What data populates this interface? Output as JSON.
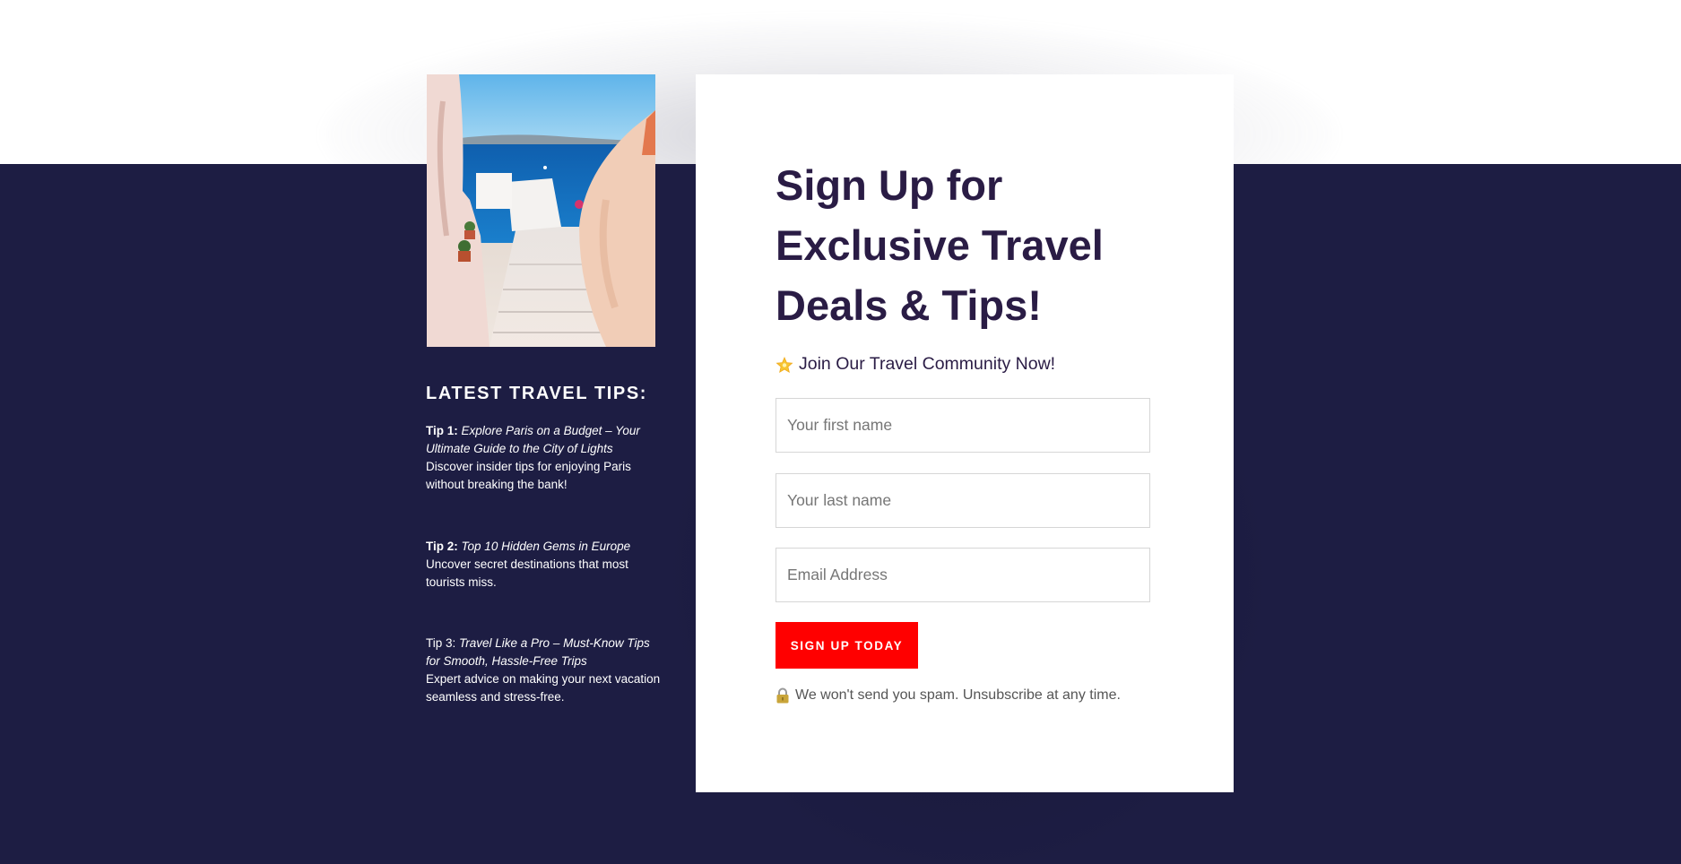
{
  "colors": {
    "band": "#1d1d43",
    "title": "#2a1c45",
    "button": "#ff0000"
  },
  "sidebar": {
    "heading": "LATEST TRAVEL TIPS:",
    "tips": [
      {
        "label": "Tip 1:",
        "title": "Explore Paris on a Budget – Your Ultimate Guide to the City of Lights",
        "description": "Discover insider tips for enjoying Paris without breaking the bank!"
      },
      {
        "label": "Tip 2:",
        "title": "Top 10 Hidden Gems in Europe",
        "description": "Uncover secret destinations that most tourists miss."
      },
      {
        "label": "Tip 3:",
        "title": "Travel Like a Pro – Must-Know Tips for Smooth, Hassle-Free Trips",
        "description": "Expert advice on making your next vacation seamless and stress-free."
      }
    ]
  },
  "form": {
    "title": "Sign Up for Exclusive Travel Deals & Tips!",
    "subtitle": "Join Our Travel Community Now!",
    "subtitle_icon": "glowing-star-icon",
    "fields": [
      {
        "placeholder": "Your first name",
        "value": ""
      },
      {
        "placeholder": "Your last name",
        "value": ""
      },
      {
        "placeholder": "Email Address",
        "value": ""
      }
    ],
    "submit_label": "SIGN UP TODAY",
    "note": "We won't send you spam. Unsubscribe at any time.",
    "note_icon": "lock-icon"
  }
}
